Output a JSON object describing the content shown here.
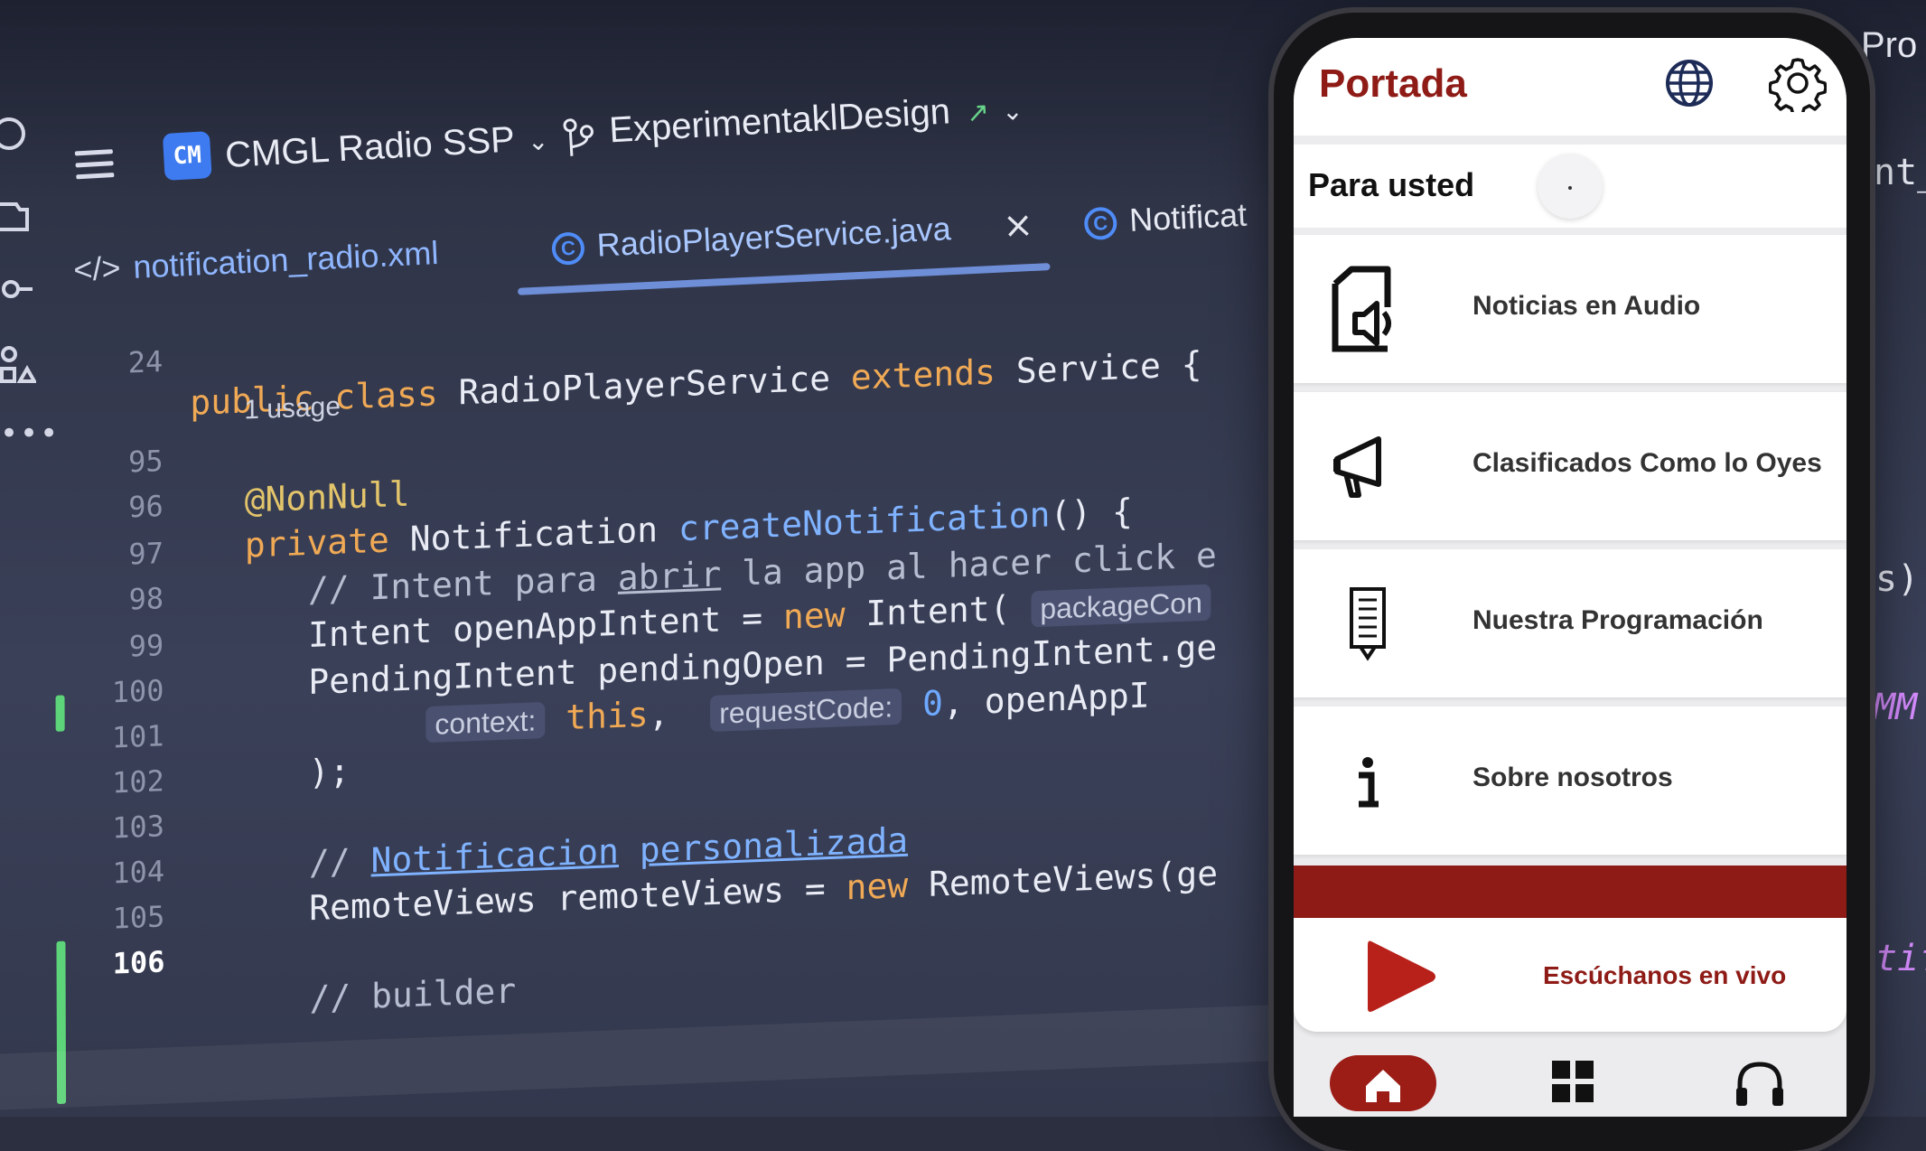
{
  "ide": {
    "project_badge": "CM",
    "project_name": "CMGL Radio SSP",
    "branch_name": "ExperimentaklDesign",
    "tabs": [
      {
        "label": "notification_radio.xml"
      },
      {
        "label": "RadioPlayerService.java",
        "active": true
      },
      {
        "label": "Notificat"
      }
    ],
    "edge_right_top": "Pro",
    "edge_right_tab": "nt_",
    "edge_right_1": "s)",
    "edge_right_2": "MM",
    "edge_right_3": "tif",
    "code": {
      "class_line_no": "24",
      "class_kw1": "public",
      "class_kw2": "class",
      "class_name": " RadioPlayerService ",
      "class_kw3": "extends",
      "class_rest": " Service {",
      "usage_hint": "1 usage",
      "lines": [
        {
          "no": "95"
        },
        {
          "no": "96"
        },
        {
          "no": "97"
        },
        {
          "no": "98"
        },
        {
          "no": "99"
        },
        {
          "no": "100"
        },
        {
          "no": "101"
        },
        {
          "no": "102"
        },
        {
          "no": "103"
        },
        {
          "no": "104"
        },
        {
          "no": "105"
        },
        {
          "no": "106"
        }
      ],
      "l95": "@NonNull",
      "l96_kw": "private",
      "l96_type": " Notification ",
      "l96_fn": "createNotification",
      "l96_rest": "() {",
      "l97_a": "// Intent para ",
      "l97_b": "abrir",
      "l97_c": " la app al hacer click e",
      "l98_a": "Intent openAppIntent = ",
      "l98_kw": "new",
      "l98_b": " Intent( ",
      "l98_hint": "packageCon",
      "l99": "PendingIntent pendingOpen = PendingIntent.ge",
      "l100_hint1": "context:",
      "l100_this": " this",
      "l100_comma": ",  ",
      "l100_hint2": "requestCode:",
      "l100_num": " 0",
      "l100_rest": ", openAppI",
      "l101": ");",
      "l103_a": "// ",
      "l103_b": "Notificacion",
      "l103_c": " ",
      "l103_d": "personalizada",
      "l104_a": "RemoteViews remoteViews = ",
      "l104_kw": "new",
      "l104_b": " RemoteViews(ge",
      "l106": "// builder"
    }
  },
  "phone": {
    "header_title": "Portada",
    "section_title": "Para usted",
    "menu": [
      {
        "label": "Noticias en Audio",
        "icon": "audio-news-icon"
      },
      {
        "label": "Clasificados Como lo Oyes",
        "icon": "megaphone-icon"
      },
      {
        "label": "Nuestra Programación",
        "icon": "schedule-icon"
      },
      {
        "label": "Sobre nosotros",
        "icon": "info-icon"
      }
    ],
    "live_label": "Escúchanos en vivo",
    "colors": {
      "brand": "#8e1b16",
      "surface": "#ffffff",
      "background": "#ececee"
    }
  }
}
